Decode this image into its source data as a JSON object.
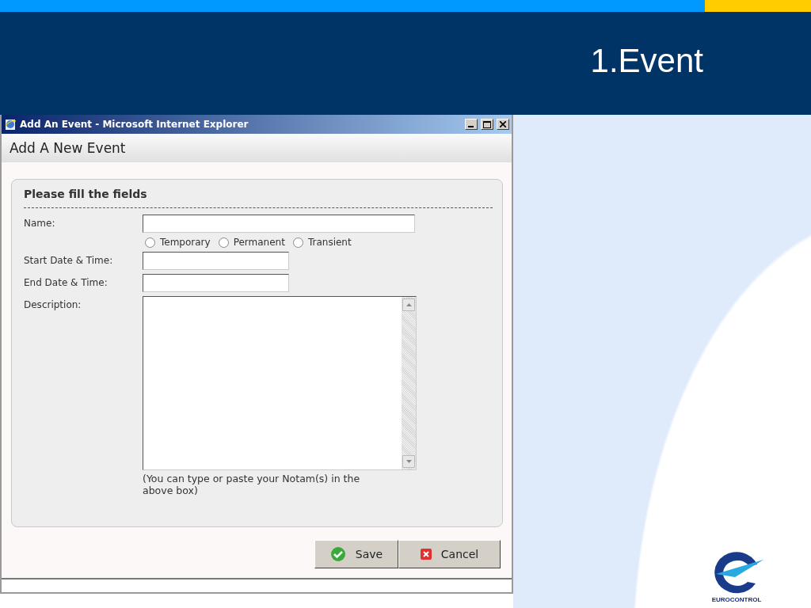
{
  "slide": {
    "title": "1.Event",
    "logo_text": "EUROCONTROL"
  },
  "window": {
    "title": "Add An Event - Microsoft Internet Explorer",
    "page_heading": "Add A New Event",
    "panel_title": "Please fill the fields",
    "rows": [
      {
        "kind": "text",
        "label": "Name:"
      },
      {
        "kind": "radios",
        "options": [
          {
            "label": "Temporary",
            "selected": false
          },
          {
            "label": "Permanent",
            "selected": false
          },
          {
            "label": "Transient",
            "selected": false
          }
        ]
      },
      {
        "kind": "date",
        "label": "Start Date & Time:"
      },
      {
        "kind": "date",
        "label": "End Date & Time:"
      },
      {
        "kind": "textarea",
        "label": "Description:",
        "note": "(You can type or paste your Notam(s) in the above box)"
      }
    ],
    "buttons": [
      {
        "kind": "save",
        "label": "Save"
      },
      {
        "kind": "cancel",
        "label": "Cancel"
      }
    ]
  }
}
